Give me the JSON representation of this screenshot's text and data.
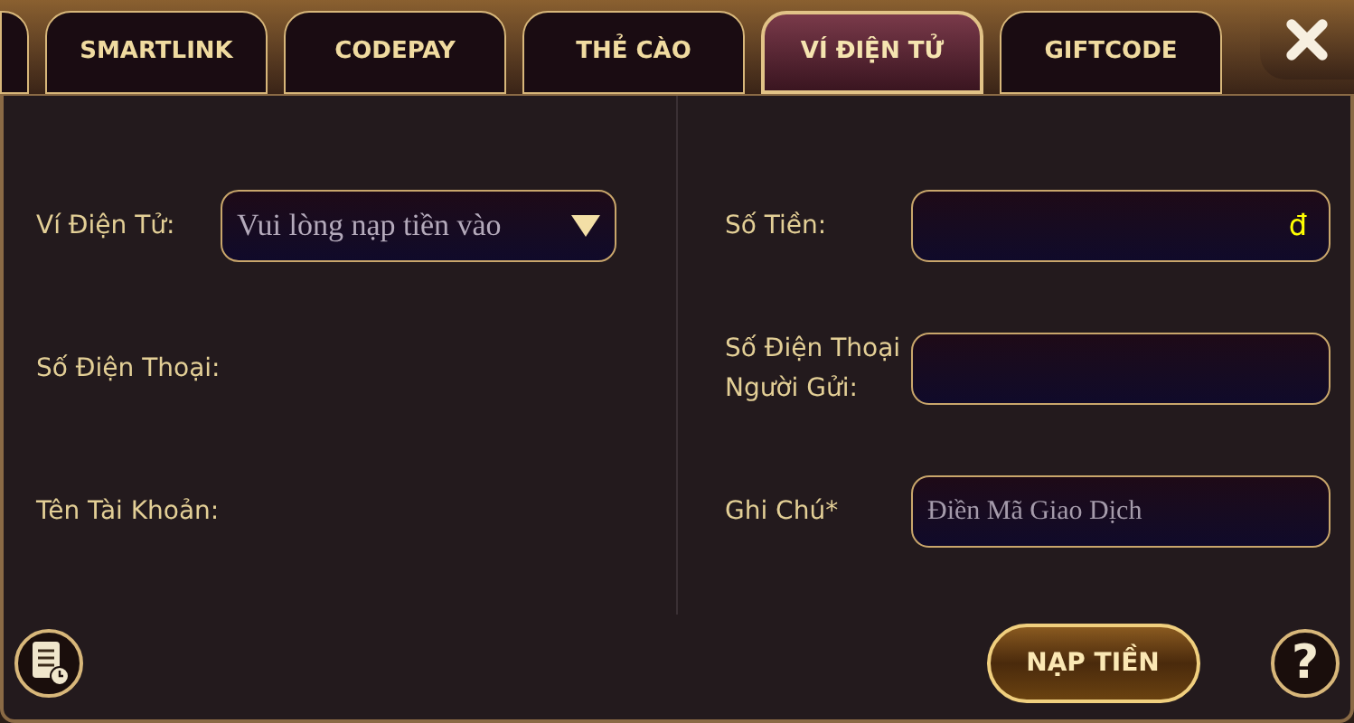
{
  "tabs": [
    {
      "label": "SMARTLINK",
      "selected": false
    },
    {
      "label": "CODEPAY",
      "selected": false
    },
    {
      "label": "THẺ CÀO",
      "selected": false
    },
    {
      "label": "VÍ ĐIỆN TỬ",
      "selected": true
    },
    {
      "label": "GIFTCODE",
      "selected": false
    }
  ],
  "left_fields": [
    {
      "kind": "dropdown",
      "label": "Ví Điện Tử:",
      "value": "Vui lòng nạp tiền vào"
    },
    {
      "kind": "label",
      "label": "Số Điện Thoại:"
    },
    {
      "kind": "label",
      "label": "Tên Tài Khoản:"
    }
  ],
  "right_fields": [
    {
      "kind": "amount",
      "label": "Số Tiền:",
      "suffix": "đ"
    },
    {
      "kind": "text",
      "label": "Số Điện Thoại Người Gửi:"
    },
    {
      "kind": "text",
      "label": "Ghi Chú*",
      "placeholder": "Điền Mã Giao Dịch"
    }
  ],
  "submit_button": "NẠP TIỀN",
  "help_button": "?"
}
